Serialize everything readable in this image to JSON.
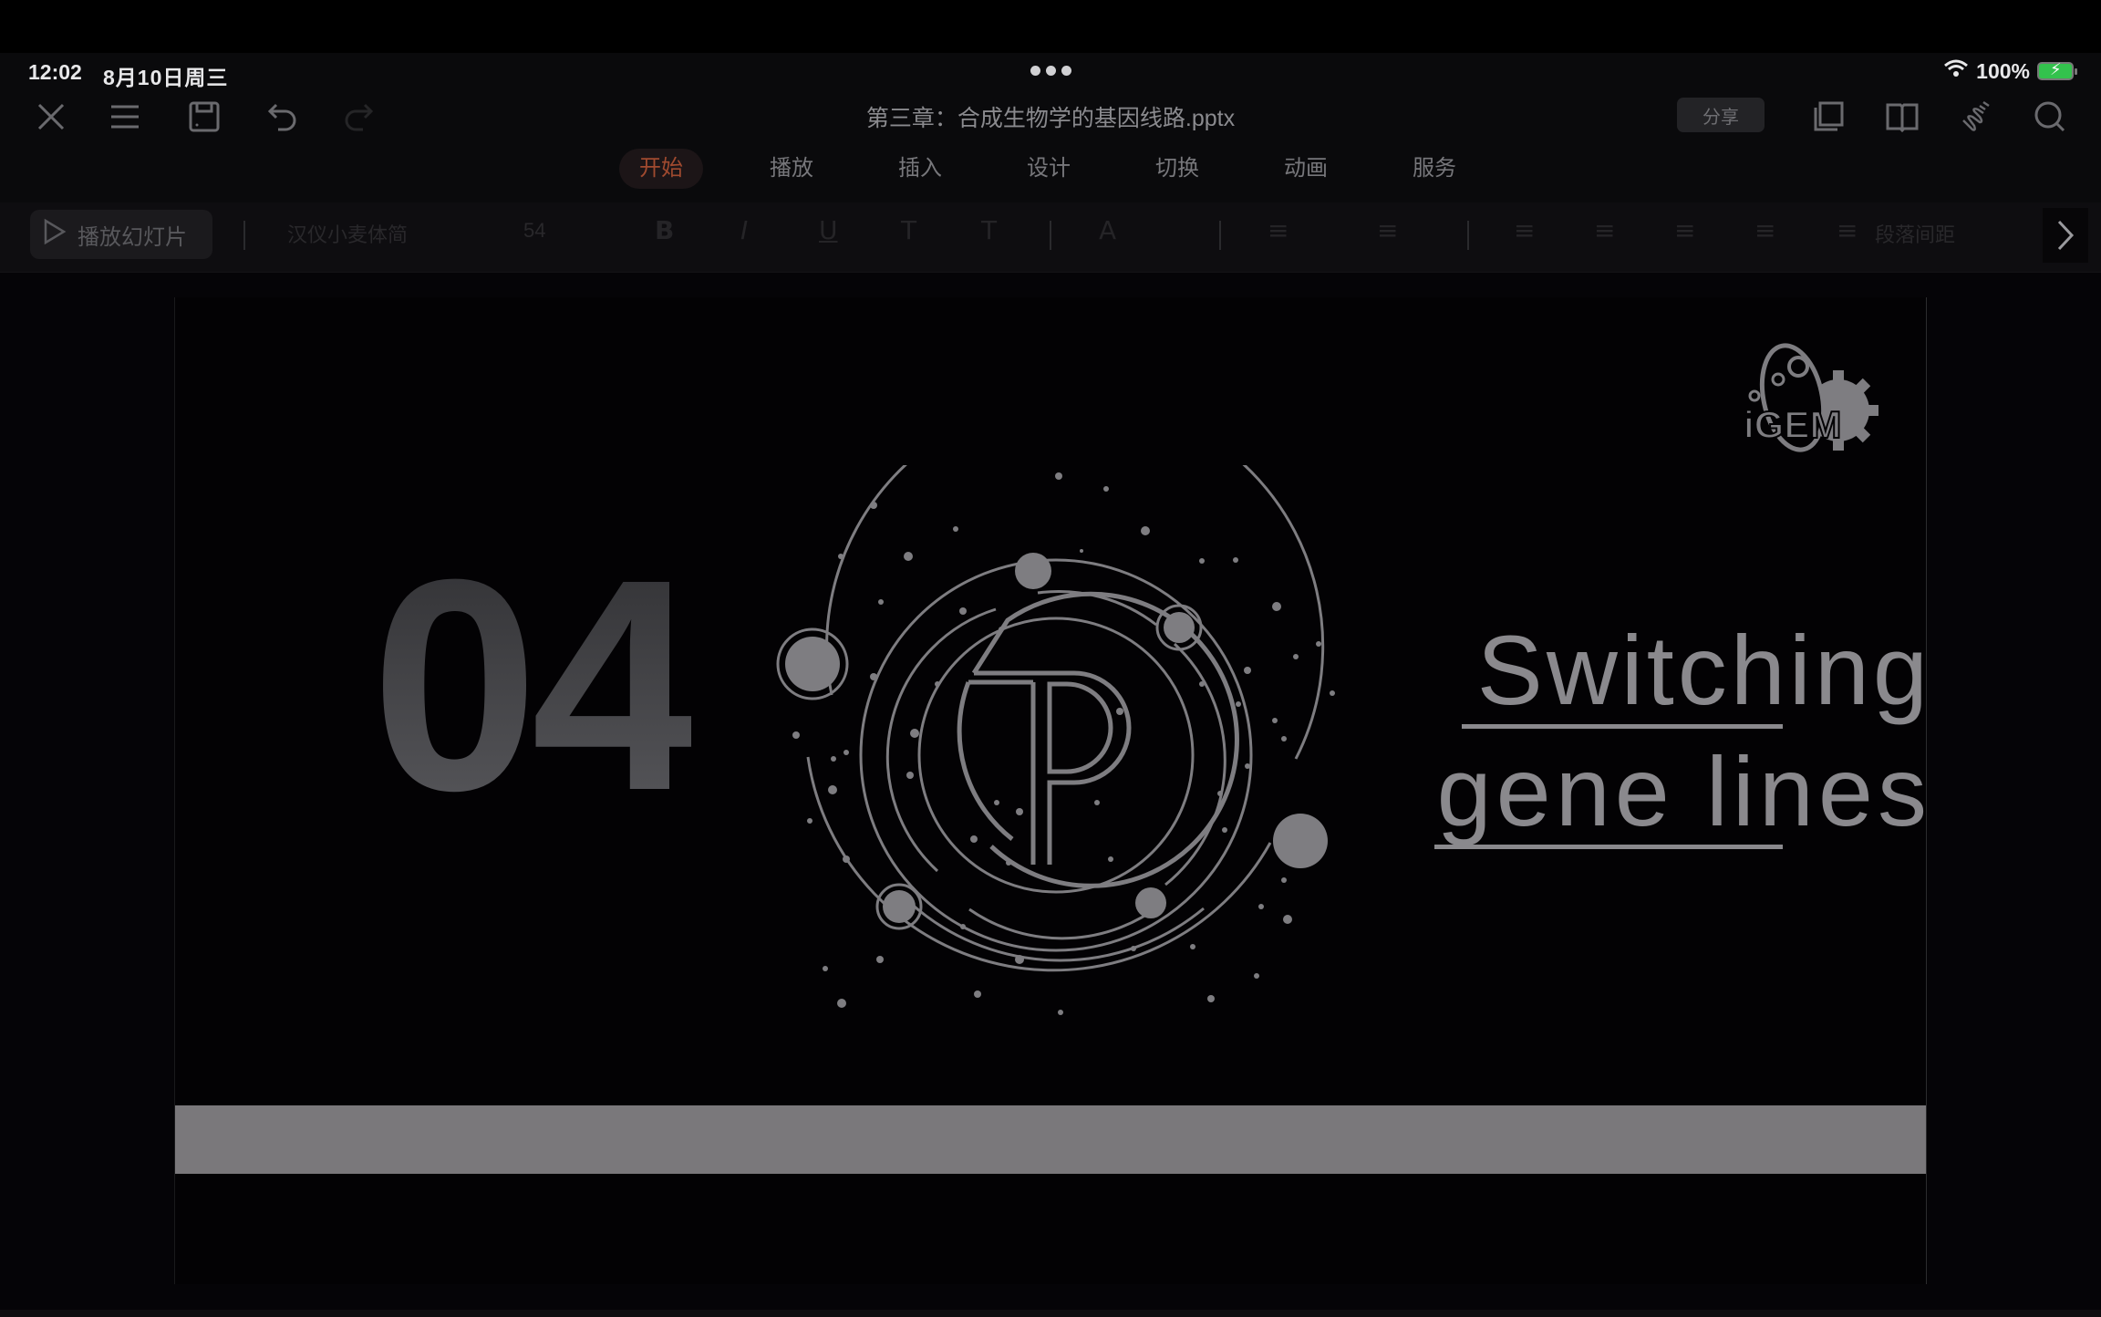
{
  "status_bar": {
    "time": "12:02",
    "date": "8月10日周三",
    "battery": "100%",
    "wifi_icon": "wifi-icon",
    "battery_color": "#33c24d"
  },
  "header": {
    "document_title": "第三章：合成生物学的基因线路.pptx",
    "share_label": "分享",
    "left_icons": [
      "close-icon",
      "menu-icon",
      "save-icon",
      "undo-icon",
      "redo-icon"
    ],
    "right_icons": [
      "multiwindow-icon",
      "reading-mode-icon",
      "pen-icon",
      "search-icon"
    ]
  },
  "tabs": [
    {
      "label": "开始",
      "active": true
    },
    {
      "label": "播放",
      "active": false
    },
    {
      "label": "插入",
      "active": false
    },
    {
      "label": "设计",
      "active": false
    },
    {
      "label": "切换",
      "active": false
    },
    {
      "label": "动画",
      "active": false
    },
    {
      "label": "服务",
      "active": false
    }
  ],
  "toolbar": {
    "play_label": "播放幻灯片",
    "font_name": "汉仪小麦体简",
    "font_size": "54",
    "bold": "B",
    "italic": "I",
    "underline": "U",
    "superscript": "T",
    "subscript": "T",
    "font_color": "A",
    "paragraph_spacing": "段落间距"
  },
  "slide": {
    "number": "04",
    "title_line1": "Switching",
    "title_line2": "gene lines",
    "logo_text": "iGEM",
    "emblem_letters": "TP",
    "bar_color": "#7a787b"
  },
  "colors": {
    "active_tab": "#a04a2f",
    "text_gray": "#8a898d"
  }
}
